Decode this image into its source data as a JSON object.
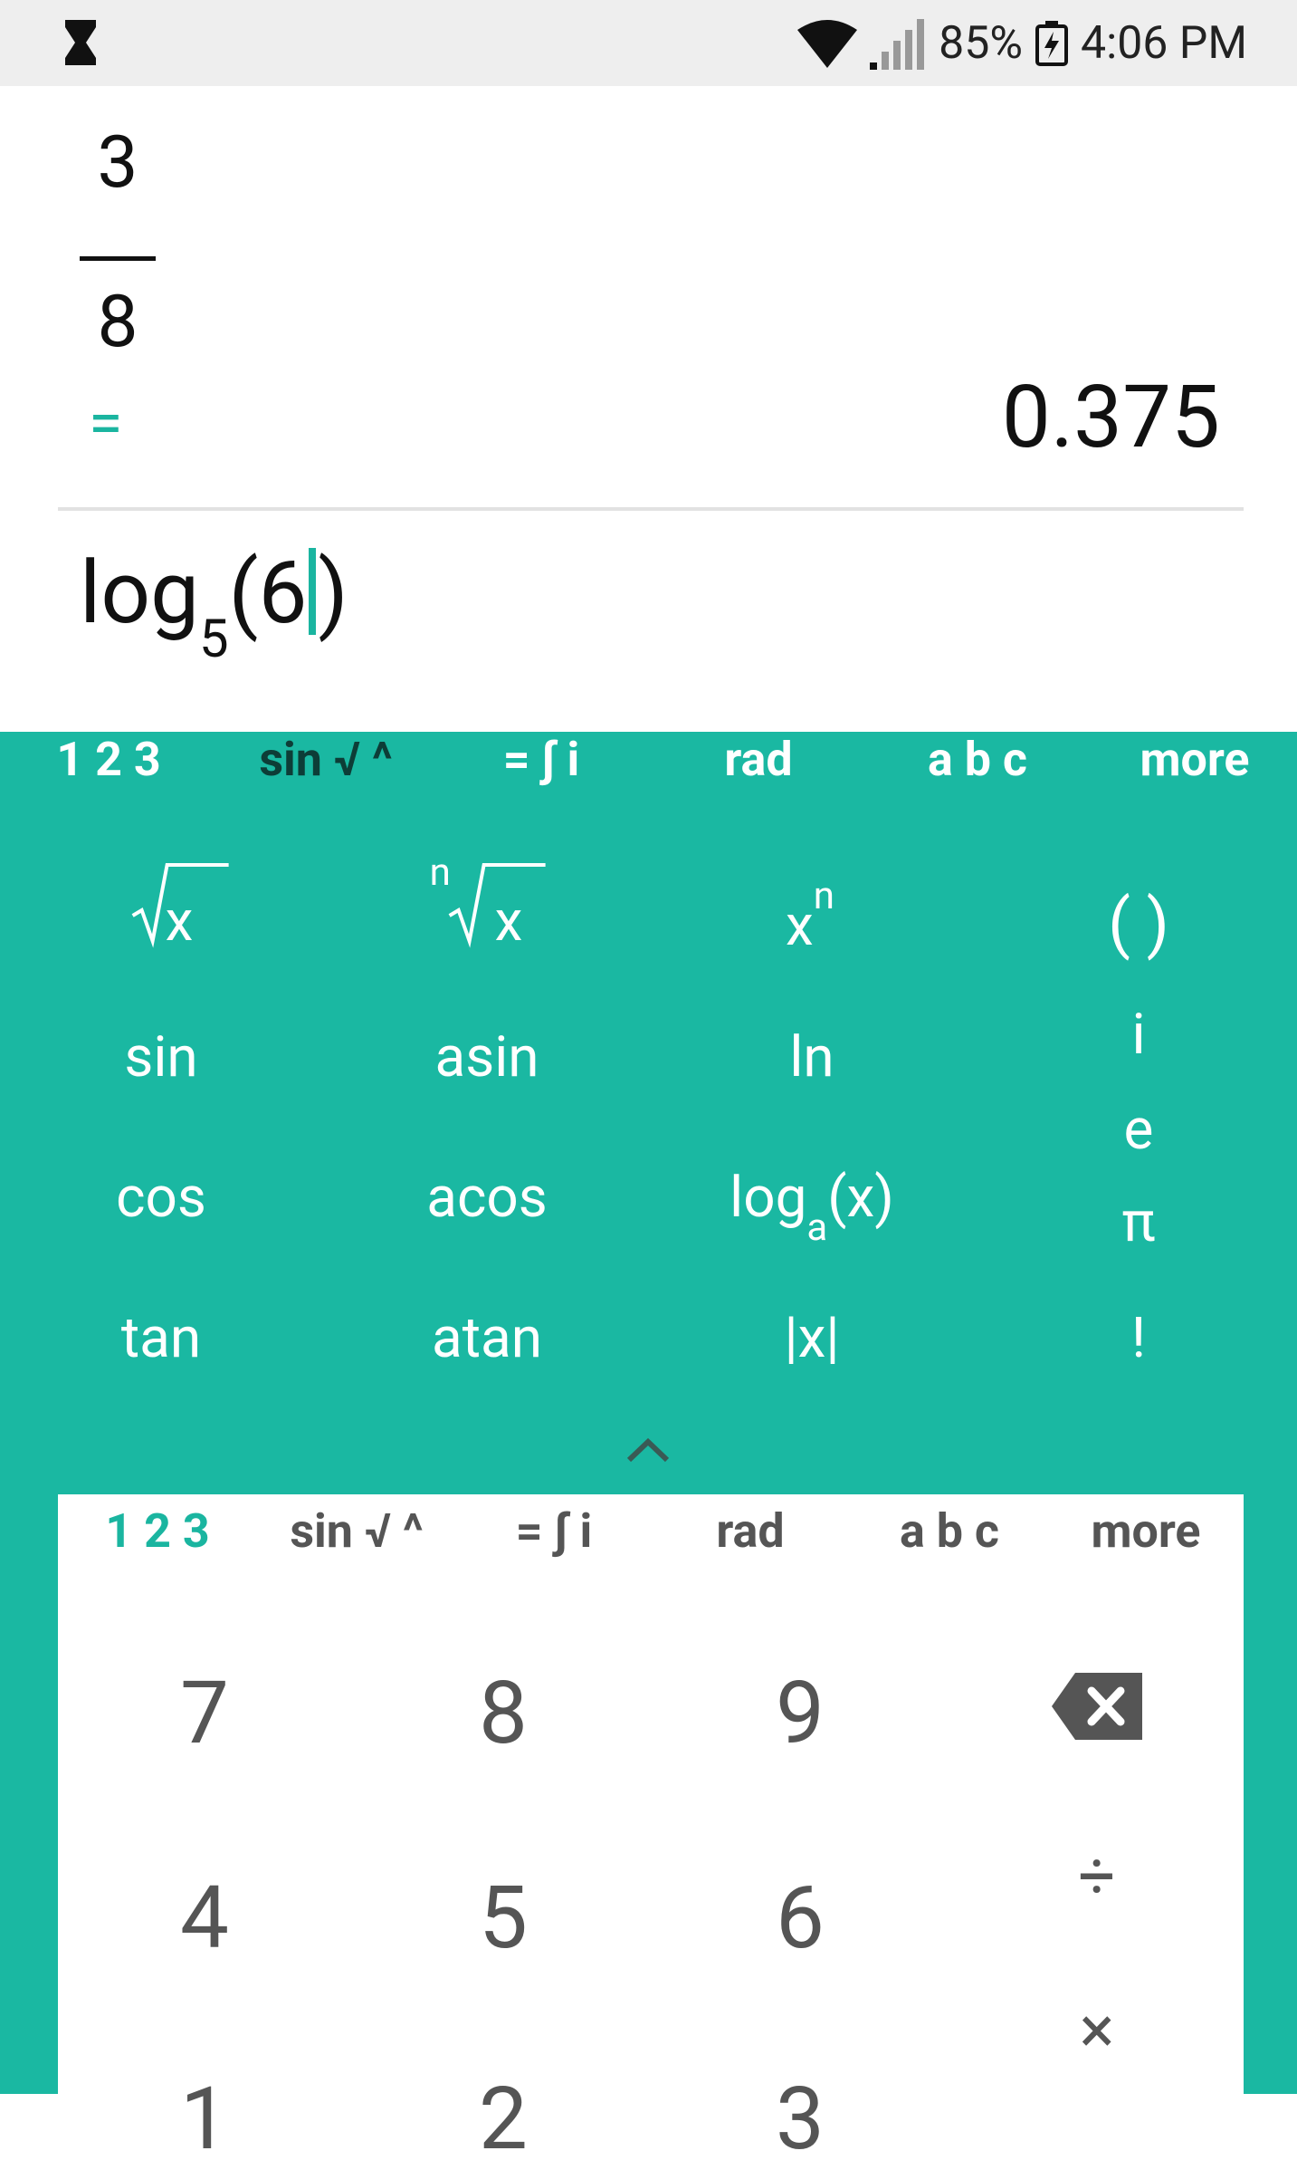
{
  "status_bar": {
    "left_icon": "hourglass-icon",
    "wifi_icon": "wifi-icon",
    "signal_icon": "signal-icon",
    "battery_percent": "85%",
    "battery_icon": "battery-charging-icon",
    "time": "4:06 PM"
  },
  "display": {
    "fraction_numerator": "3",
    "fraction_denominator": "8",
    "equals_sign": "=",
    "result": "0.375",
    "expression_prefix": "log",
    "expression_base": "5",
    "expression_open": "(6",
    "expression_close": ")"
  },
  "function_tabs": {
    "tab_123": "1 2 3",
    "tab_sin": "sin √ ^",
    "tab_eq": "= ∫ i",
    "tab_rad": "rad",
    "tab_abc": "a b c",
    "tab_more": "more"
  },
  "function_keys": {
    "sqrt_x": "x",
    "nroot_n": "n",
    "nroot_x": "x",
    "pow_x": "x",
    "pow_n": "n",
    "parens": "( )",
    "sin": "sin",
    "asin": "asin",
    "ln": "ln",
    "i": "i",
    "cos": "cos",
    "acos": "acos",
    "log_prefix": "log",
    "log_base": "a",
    "log_arg": "(x)",
    "e": "e",
    "pi": "π",
    "tan": "tan",
    "atan": "atan",
    "abs": "|x|",
    "factorial": "!"
  },
  "numpad_tabs": {
    "tab_123": "1 2 3",
    "tab_sin": "sin √ ^",
    "tab_eq": "= ∫ i",
    "tab_rad": "rad",
    "tab_abc": "a b c",
    "tab_more": "more"
  },
  "numpad": {
    "k7": "7",
    "k8": "8",
    "k9": "9",
    "k4": "4",
    "k5": "5",
    "k6": "6",
    "k1": "1",
    "k2": "2",
    "k3": "3",
    "divide": "÷",
    "multiply": "×",
    "backspace_icon": "backspace-icon"
  },
  "colors": {
    "accent": "#1ab8a2",
    "active_tab_dark": "#0d3d37"
  }
}
